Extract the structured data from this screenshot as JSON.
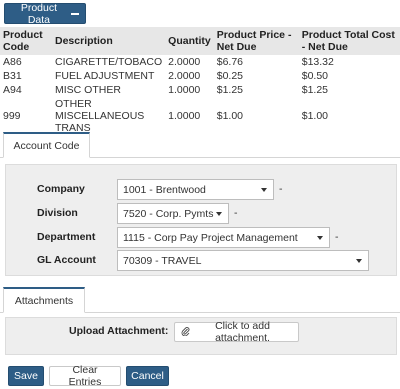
{
  "product_data_button": "Product Data",
  "products": {
    "headers": [
      "Product Code",
      "Description",
      "Quantity",
      "Product Price - Net Due",
      "Product Total Cost - Net Due"
    ],
    "rows": [
      [
        "A86",
        "CIGARETTE/TOBACO",
        "2.0000",
        "$6.76",
        "$13.32"
      ],
      [
        "B31",
        "FUEL ADJUSTMENT",
        "2.0000",
        "$0.25",
        "$0.50"
      ],
      [
        "A94",
        "MISC OTHER",
        "1.0000",
        "$1.25",
        "$1.25"
      ],
      [
        "999",
        "OTHER MISCELLANEOUS TRANS",
        "1.0000",
        "$1.00",
        "$1.00"
      ]
    ]
  },
  "account_code": {
    "tab_label": "Account Code",
    "fields": {
      "company": {
        "label": "Company",
        "value": "1001 - Brentwood"
      },
      "division": {
        "label": "Division",
        "value": "7520 - Corp. Pymts"
      },
      "department": {
        "label": "Department",
        "value": "1115 - Corp Pay Project Management"
      },
      "gl_account": {
        "label": "GL Account",
        "value": "70309 - TRAVEL"
      }
    },
    "dash": "-"
  },
  "attachments": {
    "tab_label": "Attachments",
    "upload_label": "Upload Attachment:",
    "upload_button": "Click to add attachment."
  },
  "actions": {
    "save": "Save",
    "clear": "Clear Entries",
    "cancel": "Cancel"
  }
}
